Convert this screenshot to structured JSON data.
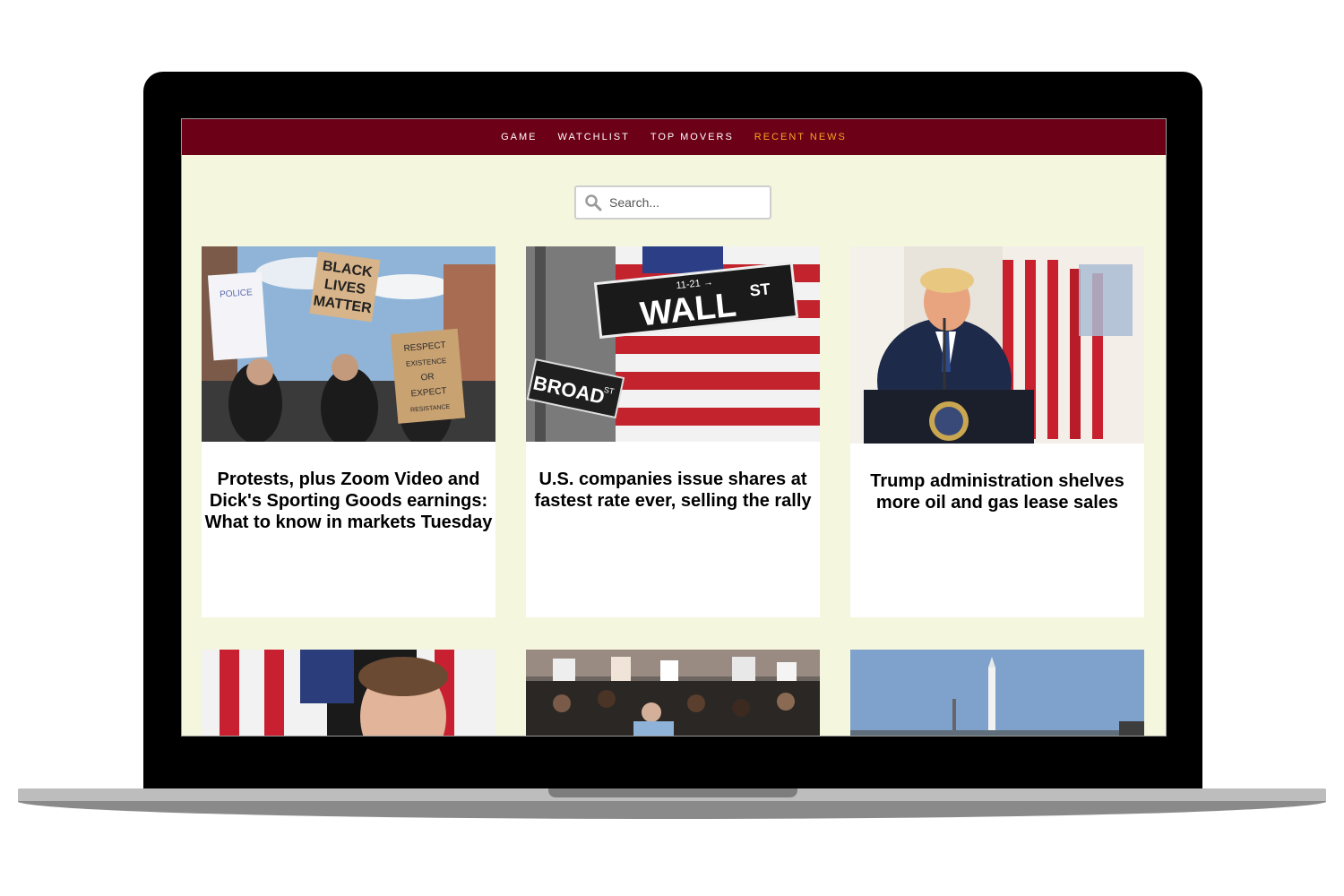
{
  "nav": {
    "items": [
      {
        "label": "GAME"
      },
      {
        "label": "WATCHLIST"
      },
      {
        "label": "TOP MOVERS"
      },
      {
        "label": "RECENT NEWS",
        "active": true
      }
    ]
  },
  "search": {
    "placeholder": "Search..."
  },
  "articles": [
    {
      "title": "Protests, plus Zoom Video and Dick's Sporting Goods earnings: What to know in markets Tuesday",
      "image": "protest-photo"
    },
    {
      "title": "U.S. companies issue shares at fastest rate ever, selling the rally",
      "image": "wall-street-sign-photo"
    },
    {
      "title": "Trump administration shelves more oil and gas lease sales",
      "image": "president-podium-photo"
    },
    {
      "title": "",
      "image": "zuckerberg-photo"
    },
    {
      "title": "",
      "image": "crowd-police-photo"
    },
    {
      "title": "",
      "image": "rocket-launch-photo"
    }
  ],
  "image_signs": {
    "blm": [
      "BLACK",
      "LIVES",
      "MATTER"
    ],
    "respect": [
      "RESPECT",
      "EXISTENCE",
      "OR",
      "EXPECT",
      "RESISTANCE"
    ],
    "police": [
      "POLICE"
    ],
    "wall": "WALL",
    "st": "ST",
    "street_no": "11-21 →",
    "broad": "BROAD",
    "broad_st": "ST"
  },
  "colors": {
    "nav_bg": "#6c0016",
    "active": "#f5a623",
    "page_bg": "#f4f6de"
  }
}
